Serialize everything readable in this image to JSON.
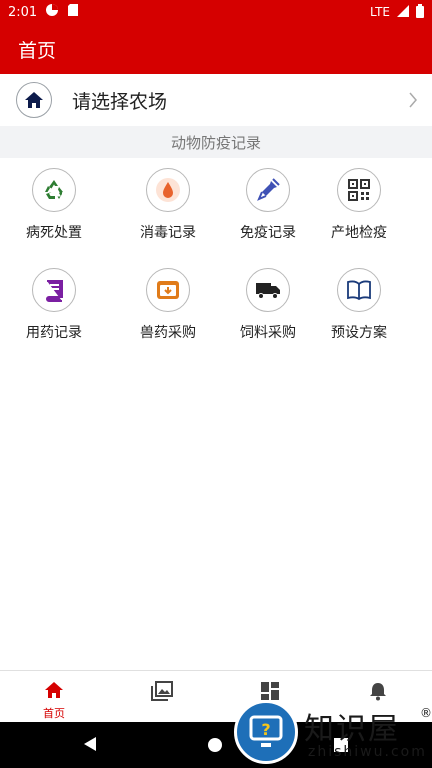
{
  "status_bar": {
    "time": "2:01",
    "network": "LTE"
  },
  "app_bar": {
    "title": "首页"
  },
  "farm_selector": {
    "label": "请选择农场"
  },
  "section": {
    "title": "动物防疫记录"
  },
  "grid": [
    {
      "label": "病死处置",
      "icon": "recycle-icon",
      "color": "#2e7d32"
    },
    {
      "label": "消毒记录",
      "icon": "drop-icon",
      "color": "#e8622c"
    },
    {
      "label": "免疫记录",
      "icon": "syringe-icon",
      "color": "#3f51b5"
    },
    {
      "label": "产地检疫",
      "icon": "qr-code-icon",
      "color": "#333333"
    },
    {
      "label": "用药记录",
      "icon": "book-icon",
      "color": "#7b1fa2"
    },
    {
      "label": "兽药采购",
      "icon": "box-icon",
      "color": "#e07b1a"
    },
    {
      "label": "饲料采购",
      "icon": "truck-icon",
      "color": "#222222"
    },
    {
      "label": "预设方案",
      "icon": "open-book-icon",
      "color": "#1a3a7a"
    }
  ],
  "bottom_nav": {
    "home_label": "首页",
    "active_color": "#d50000"
  },
  "watermark": {
    "title": "知识屋",
    "domain": "zhishiwu.com",
    "reg": "®"
  }
}
